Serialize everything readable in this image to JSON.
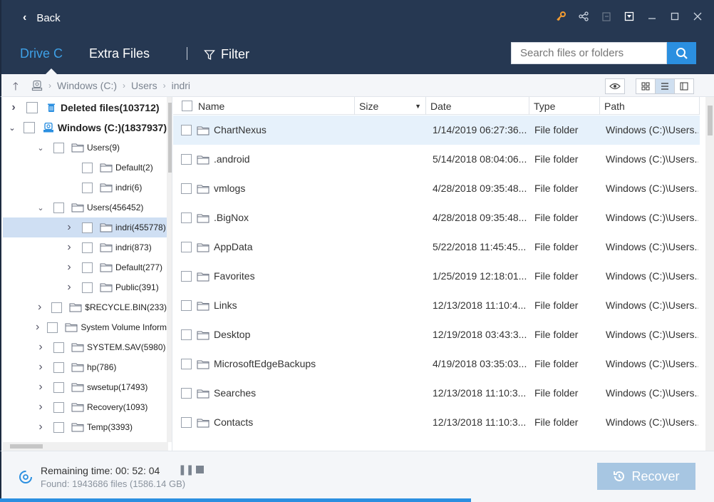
{
  "header": {
    "back_label": "Back"
  },
  "tabs": [
    {
      "label": "Drive C"
    },
    {
      "label": "Extra Files"
    }
  ],
  "filter_label": "Filter",
  "search": {
    "placeholder": "Search files or folders"
  },
  "breadcrumb": [
    "Windows (C:)",
    "Users",
    "indri"
  ],
  "tree": [
    {
      "label": "Deleted files(103712)",
      "level": 0,
      "expanded": false
    },
    {
      "label": "Windows (C:)(1837937)",
      "level": 0,
      "expanded": true
    },
    {
      "label": "Users(9)",
      "level": 1,
      "expanded": true
    },
    {
      "label": "Default(2)",
      "level": 2,
      "expanded": null
    },
    {
      "label": "indri(6)",
      "level": 2,
      "expanded": null
    },
    {
      "label": "Users(456452)",
      "level": 1,
      "expanded": true
    },
    {
      "label": "indri(455778)",
      "level": 2,
      "expanded": false,
      "selected": true
    },
    {
      "label": "indri(873)",
      "level": 2,
      "expanded": false
    },
    {
      "label": "Default(277)",
      "level": 2,
      "expanded": false
    },
    {
      "label": "Public(391)",
      "level": 2,
      "expanded": false
    },
    {
      "label": "$RECYCLE.BIN(233)",
      "level": 1,
      "expanded": false
    },
    {
      "label": "System Volume Inform",
      "level": 1,
      "expanded": false
    },
    {
      "label": "SYSTEM.SAV(5980)",
      "level": 1,
      "expanded": false
    },
    {
      "label": "hp(786)",
      "level": 1,
      "expanded": false
    },
    {
      "label": "swsetup(17493)",
      "level": 1,
      "expanded": false
    },
    {
      "label": "Recovery(1093)",
      "level": 1,
      "expanded": false
    },
    {
      "label": "Temp(3393)",
      "level": 1,
      "expanded": false
    }
  ],
  "columns": [
    "Name",
    "Size",
    "Date",
    "Type",
    "Path"
  ],
  "files": [
    {
      "name": "ChartNexus",
      "size": "",
      "date": "1/14/2019 06:27:36...",
      "type": "File folder",
      "path": "Windows (C:)\\Users..."
    },
    {
      "name": ".android",
      "size": "",
      "date": "5/14/2018 08:04:06...",
      "type": "File folder",
      "path": "Windows (C:)\\Users..."
    },
    {
      "name": "vmlogs",
      "size": "",
      "date": "4/28/2018 09:35:48...",
      "type": "File folder",
      "path": "Windows (C:)\\Users..."
    },
    {
      "name": ".BigNox",
      "size": "",
      "date": "4/28/2018 09:35:48...",
      "type": "File folder",
      "path": "Windows (C:)\\Users..."
    },
    {
      "name": "AppData",
      "size": "",
      "date": "5/22/2018 11:45:45...",
      "type": "File folder",
      "path": "Windows (C:)\\Users..."
    },
    {
      "name": "Favorites",
      "size": "",
      "date": "1/25/2019 12:18:01...",
      "type": "File folder",
      "path": "Windows (C:)\\Users..."
    },
    {
      "name": "Links",
      "size": "",
      "date": "12/13/2018 11:10:4...",
      "type": "File folder",
      "path": "Windows (C:)\\Users..."
    },
    {
      "name": "Desktop",
      "size": "",
      "date": "12/19/2018 03:43:3...",
      "type": "File folder",
      "path": "Windows (C:)\\Users..."
    },
    {
      "name": "MicrosoftEdgeBackups",
      "size": "",
      "date": "4/19/2018 03:35:03...",
      "type": "File folder",
      "path": "Windows (C:)\\Users..."
    },
    {
      "name": "Searches",
      "size": "",
      "date": "12/13/2018 11:10:3...",
      "type": "File folder",
      "path": "Windows (C:)\\Users..."
    },
    {
      "name": "Contacts",
      "size": "",
      "date": "12/13/2018 11:10:3...",
      "type": "File folder",
      "path": "Windows (C:)\\Users..."
    }
  ],
  "status": {
    "remaining": "Remaining time: 00: 52: 04",
    "found": "Found: 1943686 files (1586.14 GB)",
    "progress_fraction": 0.66
  },
  "recover_label": "Recover",
  "colors": {
    "accent": "#2b8fe0",
    "header_bg": "#263852",
    "active_tab": "#3ea0e6",
    "recover_disabled": "#a7c6e2"
  }
}
